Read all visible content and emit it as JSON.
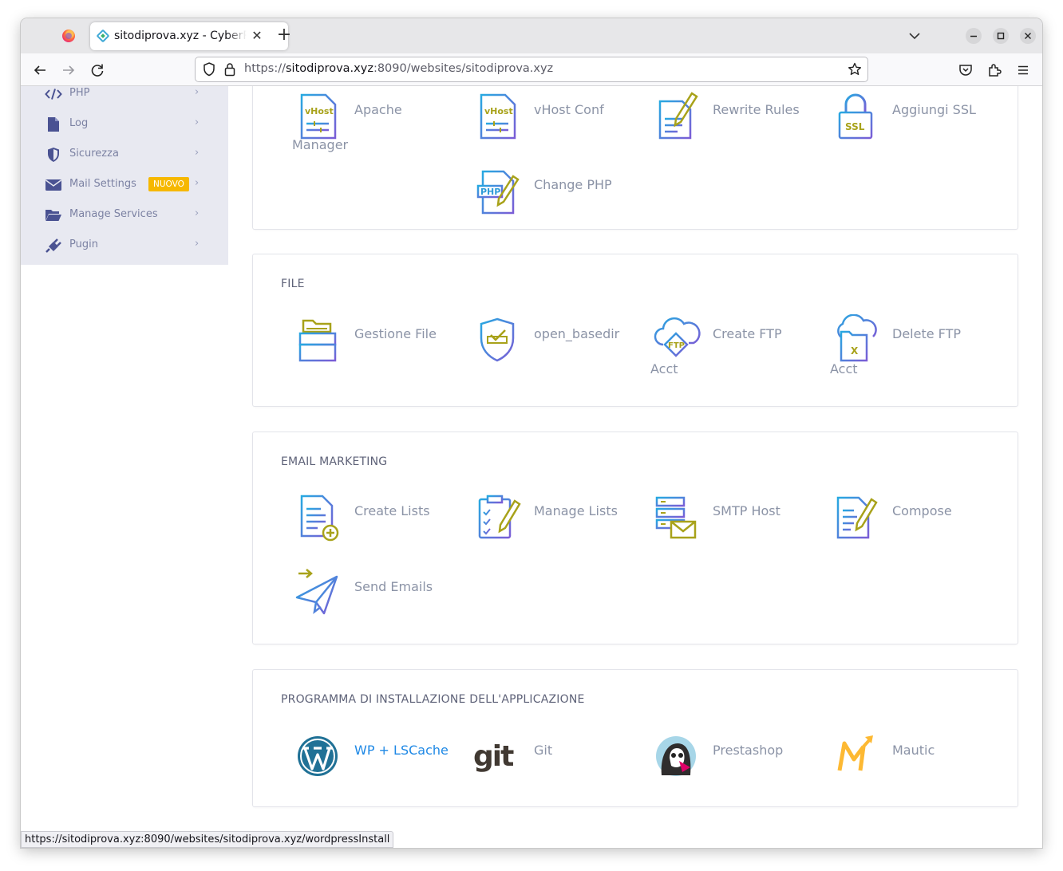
{
  "browser": {
    "tab_title": "sitodiprova.xyz - CyberPanel",
    "tab_close": "✕",
    "new_tab": "+",
    "url_prefix": "https://",
    "url_domain": "sitodiprova.xyz",
    "url_rest": ":8090/websites/sitodiprova.xyz",
    "status_url": "https://sitodiprova.xyz:8090/websites/sitodiprova.xyz/wordpressInstall"
  },
  "sidebar": {
    "items": [
      {
        "label": "PHP",
        "icon": "code-icon"
      },
      {
        "label": "Log",
        "icon": "file-icon"
      },
      {
        "label": "Sicurezza",
        "icon": "shield-icon"
      },
      {
        "label": "Mail Settings",
        "icon": "envelope-icon",
        "badge": "NUOVO"
      },
      {
        "label": "Manage Services",
        "icon": "folder-icon"
      },
      {
        "label": "Pugin",
        "icon": "plug-icon"
      }
    ]
  },
  "sections": {
    "config": {
      "tiles": [
        {
          "line1": "Apache",
          "line2": "Manager",
          "icon": "vhost-file-icon"
        },
        {
          "line1": "vHost Conf",
          "icon": "vhost-file-icon"
        },
        {
          "line1": "Rewrite Rules",
          "icon": "rewrite-icon"
        },
        {
          "line1": "Aggiungi SSL",
          "icon": "ssl-lock-icon"
        },
        {
          "line1": "Change PHP",
          "icon": "php-file-icon"
        }
      ]
    },
    "file": {
      "title": "FILE",
      "tiles": [
        {
          "line1": "Gestione File",
          "icon": "file-manager-icon"
        },
        {
          "line1": "open_basedir",
          "icon": "shield-check-icon"
        },
        {
          "line1": "Create FTP",
          "line2": "Acct",
          "icon": "ftp-cloud-icon"
        },
        {
          "line1": "Delete FTP",
          "line2": "Acct",
          "icon": "ftp-delete-icon"
        }
      ]
    },
    "email": {
      "title": "EMAIL MARKETING",
      "tiles": [
        {
          "line1": "Create Lists",
          "icon": "create-list-icon"
        },
        {
          "line1": "Manage Lists",
          "icon": "clipboard-icon"
        },
        {
          "line1": "SMTP Host",
          "icon": "smtp-server-icon"
        },
        {
          "line1": "Compose",
          "icon": "compose-icon"
        },
        {
          "line1": "Send Emails",
          "icon": "paper-plane-icon"
        }
      ]
    },
    "apps": {
      "title": "PROGRAMMA DI INSTALLAZIONE DELL'APPLICAZIONE",
      "tiles": [
        {
          "line1": "WP + LSCache",
          "icon": "wordpress-icon"
        },
        {
          "line1": "Git",
          "icon": "git-logo-icon"
        },
        {
          "line1": "Prestashop",
          "icon": "prestashop-icon"
        },
        {
          "line1": "Mautic",
          "icon": "mautic-icon"
        }
      ]
    }
  },
  "icon_text": {
    "vhost": "vHost",
    "ssl": "SSL",
    "php": "PHP",
    "ftp": "FTP",
    "del": "X",
    "git": "git"
  },
  "colors": {
    "icon_blue": "#2e9bd8",
    "icon_purple": "#6a5acd",
    "icon_olive": "#a8a21a",
    "link_blue": "#1e88e5",
    "badge": "#f6b800",
    "sidebar_bg": "#e8e9f1"
  }
}
